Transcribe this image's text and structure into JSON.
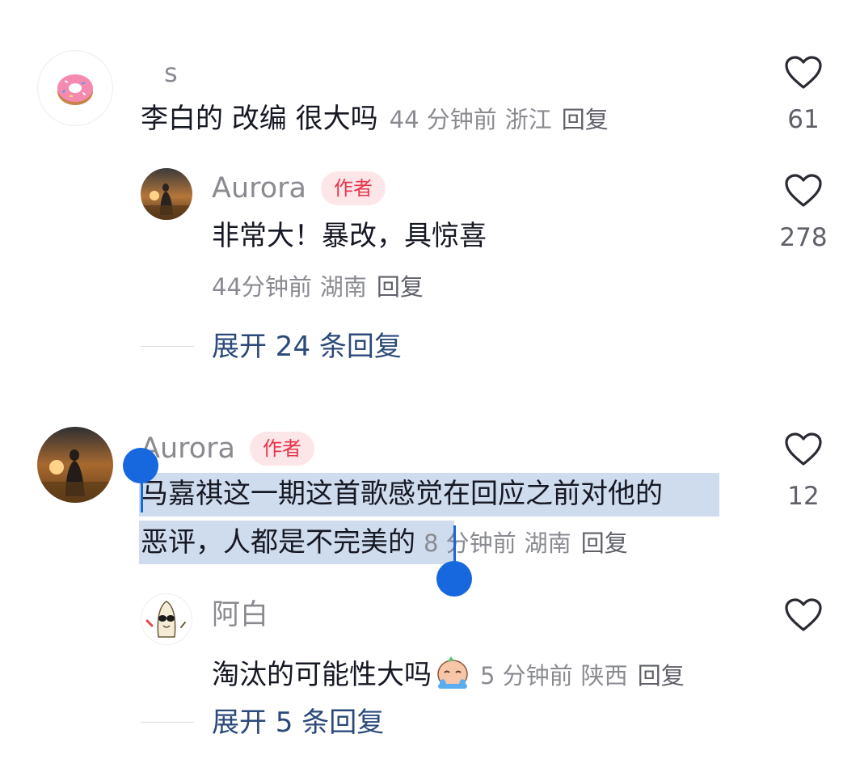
{
  "comments": [
    {
      "user": "s",
      "text": "李白的 改编 很大吗",
      "time": "44 分钟前",
      "location": "浙江",
      "reply_label": "回复",
      "likes": "61",
      "replies": [
        {
          "user": "Aurora",
          "badge": "作者",
          "text": "非常大！暴改，具惊喜",
          "time": "44分钟前",
          "location": "湖南",
          "reply_label": "回复",
          "likes": "278"
        }
      ],
      "expand_label": "展开 24 条回复"
    },
    {
      "user": "Aurora",
      "badge": "作者",
      "text_line1": "马嘉祺这一期这首歌感觉在回应之前对他的",
      "text_line2": "恶评，人都是不完美的",
      "time": "8 分钟前",
      "location": "湖南",
      "reply_label": "回复",
      "likes": "12",
      "replies": [
        {
          "user": "阿白",
          "text": "淘汰的可能性大吗",
          "time": "5 分钟前",
          "location": "陕西",
          "reply_label": "回复",
          "likes": ""
        }
      ],
      "expand_label": "展开 5 条回复"
    }
  ],
  "colors": {
    "accent_blue": "#1767de",
    "selection": "#cfdced",
    "badge_bg": "#fde6e8",
    "badge_text": "#e7344b",
    "expand_text": "#2b4a7a"
  }
}
